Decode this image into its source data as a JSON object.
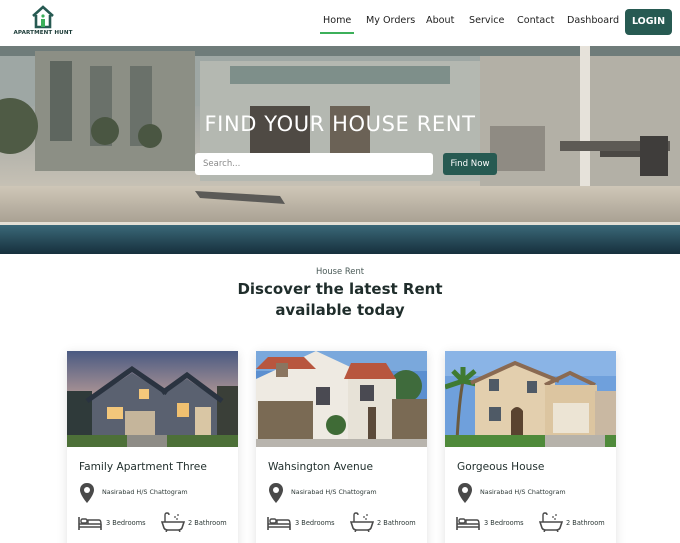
{
  "brand": {
    "name": "APARTMENT HUNT",
    "primary_color": "#275a52",
    "active_underline_color": "#3cb05a"
  },
  "nav": {
    "items": [
      {
        "label": "Home",
        "active": true
      },
      {
        "label": "My Orders",
        "active": false
      },
      {
        "label": "About",
        "active": false
      },
      {
        "label": "Service",
        "active": false
      },
      {
        "label": "Contact",
        "active": false
      },
      {
        "label": "Dashboard",
        "active": false
      }
    ],
    "login_label": "LOGIN"
  },
  "hero": {
    "title": "FIND YOUR HOUSE RENT",
    "search_placeholder": "Search...",
    "search_value": "",
    "search_button": "Find Now"
  },
  "section": {
    "eyebrow": "House Rent",
    "title_line1": "Discover the latest Rent",
    "title_line2": "available today"
  },
  "cards": [
    {
      "title": "Family Apartment Three",
      "location": "Nasirabad H/S Chattogram",
      "bedrooms": "3 Bedrooms",
      "bathrooms": "2 Bathroom"
    },
    {
      "title": "Wahsington Avenue",
      "location": "Nasirabad H/S Chattogram",
      "bedrooms": "3 Bedrooms",
      "bathrooms": "2 Bathroom"
    },
    {
      "title": "Gorgeous House",
      "location": "Nasirabad H/S Chattogram",
      "bedrooms": "3 Bedrooms",
      "bathrooms": "2 Bathroom"
    }
  ],
  "icons": {
    "logo": "house-logo-icon",
    "location": "map-pin-icon",
    "bed": "bed-icon",
    "bath": "bathtub-icon"
  }
}
